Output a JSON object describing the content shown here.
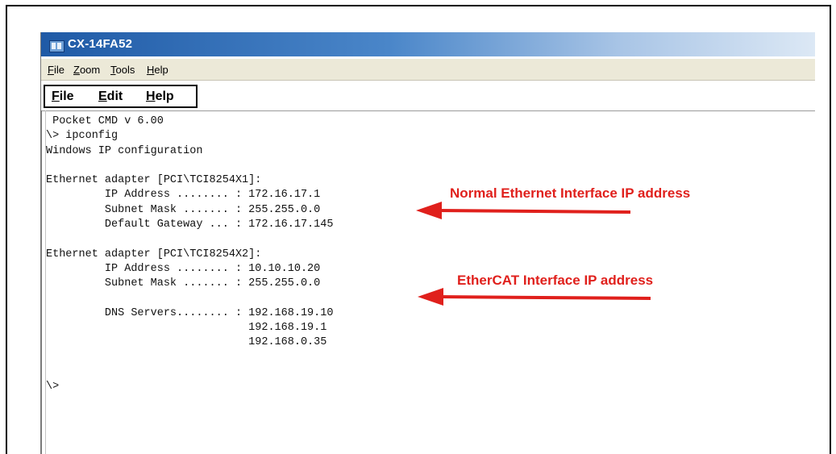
{
  "figure_id": "TT3108-01GB",
  "window": {
    "title": "CX-14FA52"
  },
  "menubar": [
    {
      "label": "File",
      "hotkey": "F"
    },
    {
      "label": "Zoom",
      "hotkey": "Z"
    },
    {
      "label": "Tools",
      "hotkey": "T"
    },
    {
      "label": "Help",
      "hotkey": "H"
    }
  ],
  "app_menu": [
    {
      "label": "File",
      "hotkey": "F"
    },
    {
      "label": "Edit",
      "hotkey": "E"
    },
    {
      "label": "Help",
      "hotkey": "H"
    }
  ],
  "console": {
    "lines": [
      " Pocket CMD v 6.00",
      "\\> ipconfig",
      "Windows IP configuration",
      "",
      "Ethernet adapter [PCI\\TCI8254X1]:",
      "         IP Address ........ : 172.16.17.1",
      "         Subnet Mask ....... : 255.255.0.0",
      "         Default Gateway ... : 172.16.17.145",
      "",
      "Ethernet adapter [PCI\\TCI8254X2]:",
      "         IP Address ........ : 10.10.10.20",
      "         Subnet Mask ....... : 255.255.0.0",
      "",
      "         DNS Servers........ : 192.168.19.10",
      "                               192.168.19.1",
      "                               192.168.0.35",
      "",
      "",
      "\\>"
    ]
  },
  "annotations": {
    "normal_label": "Normal Ethernet Interface IP address",
    "ethercat_label": "EtherCAT Interface IP address",
    "color": "#e0201c"
  }
}
